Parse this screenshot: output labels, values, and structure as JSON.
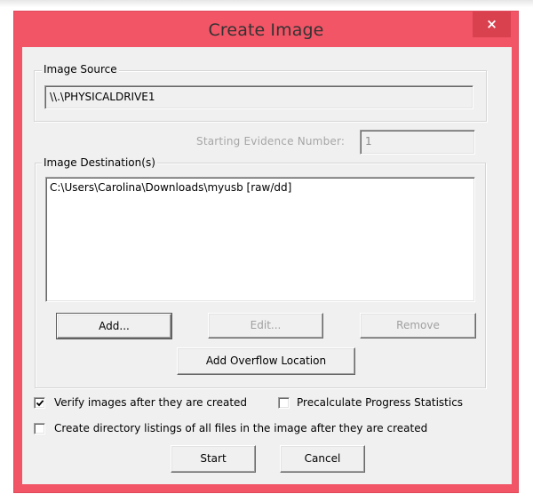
{
  "window": {
    "title": "Create Image",
    "close_icon": "×",
    "accent_color": "#f15566"
  },
  "image_source": {
    "group_label": "Image Source",
    "value": "\\\\.\\PHYSICALDRIVE1"
  },
  "evidence": {
    "label": "Starting Evidence Number:",
    "value": "1"
  },
  "image_destinations": {
    "group_label": "Image Destination(s)",
    "items": [
      "C:\\Users\\Carolina\\Downloads\\myusb [raw/dd]"
    ],
    "buttons": {
      "add": "Add...",
      "edit": "Edit...",
      "remove": "Remove",
      "add_overflow": "Add Overflow Location"
    }
  },
  "options": {
    "verify": {
      "label": "Verify images after they are created",
      "checked": true
    },
    "precalculate": {
      "label": "Precalculate Progress Statistics",
      "checked": false
    },
    "directory_listings": {
      "label": "Create directory listings of all files in the image after they are created",
      "checked": false
    }
  },
  "footer": {
    "start": "Start",
    "cancel": "Cancel"
  }
}
